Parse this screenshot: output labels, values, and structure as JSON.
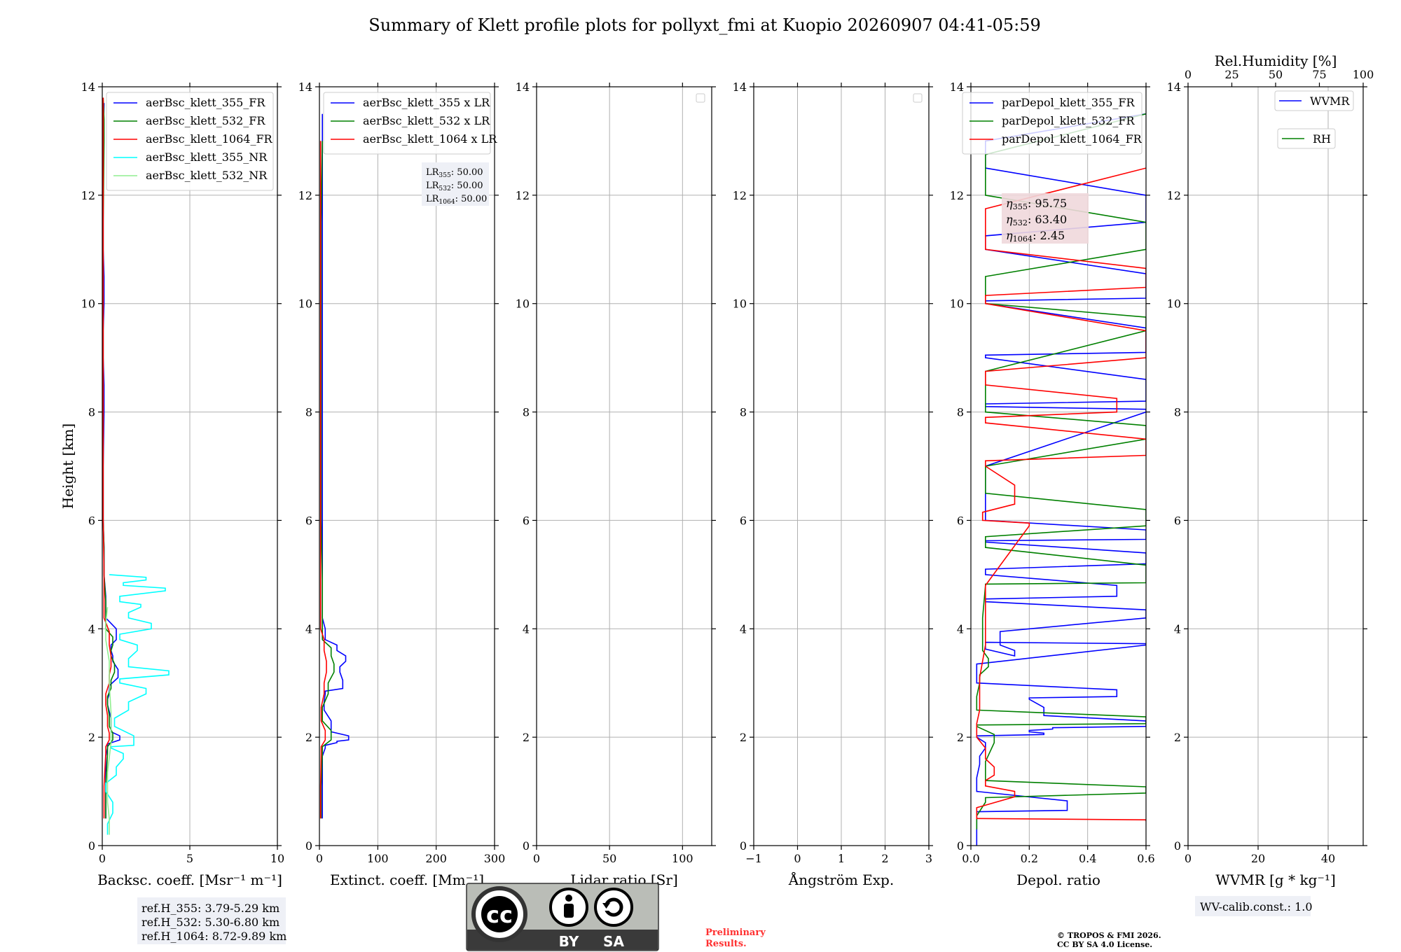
{
  "title": "Summary of Klett profile plots for pollyxt_fmi at Kuopio 20260907 04:41-05:59",
  "notes": {
    "ref_heights": [
      "ref.H_355: 3.79-5.29 km",
      "ref.H_532: 5.30-6.80 km",
      "ref.H_1064: 8.72-9.89 km"
    ],
    "preliminary": [
      "Preliminary",
      "Results."
    ],
    "copyright": [
      "© TROPOS & FMI 2026.",
      "CC BY SA 4.0 License."
    ],
    "wv_calib": "WV-calib.const.: 1.0",
    "cc_logo": {
      "by": "BY",
      "sa": "SA"
    }
  },
  "colors": {
    "blue": "#0000ff",
    "green": "#008000",
    "red": "#ff0000",
    "cyan": "#00ffff",
    "lightgreen": "#90ee90",
    "grid": "#b0b0b0"
  },
  "chart_data": [
    {
      "type": "line",
      "xlabel": "Backsc. coeff. [Msr⁻¹ m⁻¹]",
      "ylabel": "Height [km]",
      "xlim": [
        0,
        10
      ],
      "ylim": [
        0,
        14
      ],
      "xticks": [
        0,
        5,
        10
      ],
      "yticks": [
        0,
        2,
        4,
        6,
        8,
        10,
        12,
        14
      ],
      "grid": true,
      "legend_position": "top-right",
      "series": [
        {
          "name": "aerBsc_klett_355_FR",
          "color": "#0000ff",
          "x": [
            0.2,
            0.2,
            0.3,
            1.0,
            0.5,
            0.3,
            0.4,
            0.9,
            0.6,
            0.5,
            0.8,
            0.2,
            0.1,
            0.05,
            0.1,
            0.05,
            0.1,
            0.05,
            0.05,
            0.1
          ],
          "y": [
            0.5,
            1.5,
            1.8,
            1.95,
            2.1,
            2.6,
            2.8,
            3.1,
            3.4,
            3.6,
            3.8,
            4.2,
            5.0,
            6.0,
            8.0,
            9.0,
            10.0,
            11.0,
            12.0,
            13.7
          ]
        },
        {
          "name": "aerBsc_klett_532_FR",
          "color": "#008000",
          "x": [
            0.2,
            0.3,
            0.6,
            0.4,
            0.3,
            0.5,
            0.7,
            0.5,
            0.6,
            0.2,
            0.1,
            0.05,
            0.05,
            0.05,
            0.1,
            0.05
          ],
          "y": [
            0.5,
            1.7,
            1.95,
            2.2,
            2.6,
            2.9,
            3.2,
            3.5,
            3.7,
            4.0,
            5.0,
            6.0,
            8.0,
            10.0,
            13.0,
            13.8
          ]
        },
        {
          "name": "aerBsc_klett_1064_FR",
          "color": "#ff0000",
          "x": [
            0.1,
            0.2,
            0.4,
            0.3,
            0.2,
            0.4,
            0.5,
            0.4,
            0.1,
            0.05,
            0.05,
            0.05,
            0.05
          ],
          "y": [
            0.5,
            1.7,
            1.95,
            2.2,
            2.6,
            3.0,
            3.3,
            3.7,
            4.2,
            6.0,
            8.0,
            10.0,
            13.8
          ]
        },
        {
          "name": "aerBsc_klett_355_NR",
          "color": "#00ffff",
          "x": [
            0.3,
            0.6,
            0.2,
            0.8,
            1.2,
            0.5,
            1.8,
            0.7,
            1.5,
            2.5,
            1.0,
            3.8,
            1.5,
            2.0,
            1.0,
            2.8,
            1.5,
            2.2,
            1.0,
            3.6,
            1.2,
            2.5,
            0.4
          ],
          "y": [
            0.2,
            0.6,
            1.0,
            1.3,
            1.6,
            1.8,
            1.85,
            2.2,
            2.5,
            2.8,
            3.0,
            3.15,
            3.3,
            3.6,
            3.8,
            4.0,
            4.2,
            4.4,
            4.5,
            4.7,
            4.8,
            4.9,
            5.0
          ]
        },
        {
          "name": "aerBsc_klett_532_NR",
          "color": "#90ee90",
          "x": [
            0.4,
            0.3,
            0.5,
            0.4,
            0.2,
            0.3
          ],
          "y": [
            0.2,
            0.8,
            1.9,
            3.0,
            3.8,
            4.4
          ]
        }
      ]
    },
    {
      "type": "line",
      "xlabel": "Extinct. coeff. [Mm⁻¹]",
      "xlim": [
        0,
        300
      ],
      "ylim": [
        0,
        14
      ],
      "xticks": [
        0,
        100,
        200,
        300
      ],
      "yticks": [
        0,
        2,
        4,
        6,
        8,
        10,
        12,
        14
      ],
      "grid": true,
      "legend_position": "top-right",
      "annotation": [
        "LR355: 50.00",
        "LR532: 50.00",
        "LR1064: 50.00"
      ],
      "series": [
        {
          "name": "aerBsc_klett_355 x LR",
          "color": "#0000ff",
          "x": [
            5,
            5,
            10,
            30,
            50,
            20,
            8,
            10,
            40,
            35,
            45,
            30,
            10,
            5,
            5,
            5,
            5,
            5
          ],
          "y": [
            0.5,
            1.5,
            1.8,
            1.9,
            1.95,
            2.1,
            2.5,
            2.8,
            2.9,
            3.2,
            3.4,
            3.6,
            3.8,
            4.2,
            6.0,
            8.0,
            11.0,
            13.5
          ]
        },
        {
          "name": "aerBsc_klett_532 x LR",
          "color": "#008000",
          "x": [
            3,
            5,
            20,
            5,
            15,
            25,
            20,
            5,
            3,
            3,
            5
          ],
          "y": [
            0.5,
            1.7,
            1.95,
            2.3,
            2.8,
            3.2,
            3.5,
            3.8,
            6.0,
            10.0,
            13.0
          ]
        },
        {
          "name": "aerBsc_klett_1064 x LR",
          "color": "#ff0000",
          "x": [
            2,
            3,
            10,
            3,
            8,
            12,
            8,
            2,
            2
          ],
          "y": [
            0.5,
            1.7,
            1.95,
            2.3,
            2.8,
            3.2,
            3.6,
            4.0,
            13.0
          ]
        }
      ]
    },
    {
      "type": "line",
      "xlabel": "Lidar ratio [Sr]",
      "xlim": [
        0,
        120
      ],
      "ylim": [
        0,
        14
      ],
      "xticks": [
        0,
        50,
        100
      ],
      "yticks": [
        0,
        2,
        4,
        6,
        8,
        10,
        12,
        14
      ],
      "grid": true,
      "series": []
    },
    {
      "type": "line",
      "xlabel": "Ångström Exp.",
      "xlim": [
        -1,
        3
      ],
      "ylim": [
        0,
        14
      ],
      "xticks": [
        -1,
        0,
        1,
        2,
        3
      ],
      "yticks": [
        0,
        2,
        4,
        6,
        8,
        10,
        12,
        14
      ],
      "grid": true,
      "series": []
    },
    {
      "type": "line",
      "xlabel": "Depol. ratio",
      "xlim": [
        0,
        0.6
      ],
      "ylim": [
        0,
        14
      ],
      "xticks": [
        0.0,
        0.2,
        0.4,
        0.6
      ],
      "yticks": [
        0,
        2,
        4,
        6,
        8,
        10,
        12,
        14
      ],
      "grid": true,
      "legend_position": "top-right",
      "annotation": [
        "η355: 95.75",
        "η532: 63.40",
        "η1064: 2.45"
      ],
      "series": [
        {
          "name": "parDepol_klett_355_FR",
          "color": "#0000ff",
          "x": [
            0.02,
            0.02,
            0.33,
            0.02,
            0.03,
            0.05,
            0.02,
            0.25,
            0.2,
            0.28,
            0.6,
            0.25,
            0.2,
            0.5,
            0.02,
            0.6,
            0.05,
            0.15,
            0.1,
            0.6,
            0.05,
            0.5,
            0.05,
            0.6,
            0.05,
            0.6,
            0.05,
            0.6,
            0.05,
            0.6,
            0.05,
            0.6,
            0.05,
            0.6,
            0.05,
            0.6,
            0.05,
            0.6
          ],
          "y": [
            0.0,
            0.6,
            0.65,
            1.0,
            1.5,
            1.8,
            2.0,
            2.05,
            2.1,
            2.15,
            2.2,
            2.4,
            2.7,
            2.75,
            3.0,
            3.7,
            3.75,
            3.5,
            3.7,
            4.2,
            4.5,
            4.6,
            5.0,
            5.2,
            5.6,
            5.65,
            6.0,
            8.0,
            8.1,
            8.2,
            9.0,
            9.1,
            10.0,
            10.1,
            11.0,
            11.5,
            12.5,
            13.5
          ]
        },
        {
          "name": "parDepol_klett_532_FR",
          "color": "#008000",
          "x": [
            0.02,
            0.05,
            0.6,
            0.05,
            0.08,
            0.02,
            0.6,
            0.02,
            0.03,
            0.06,
            0.04,
            0.05,
            0.6,
            0.05,
            0.6,
            0.05,
            0.6,
            0.05,
            0.6,
            0.05,
            0.6,
            0.05,
            0.6
          ],
          "y": [
            0.3,
            0.8,
            0.97,
            1.2,
            1.9,
            2.2,
            2.25,
            2.5,
            3.0,
            3.3,
            3.6,
            4.8,
            4.85,
            5.5,
            5.9,
            6.5,
            7.5,
            8.0,
            9.5,
            10.0,
            11.0,
            12.0,
            13.5
          ]
        },
        {
          "name": "parDepol_klett_1064_FR",
          "color": "#ff0000",
          "x": [
            0.6,
            0.02,
            0.15,
            0.05,
            0.08,
            0.05,
            0.02,
            0.03,
            0.05,
            0.2,
            0.04,
            0.15,
            0.05,
            0.6,
            0.05,
            0.5,
            0.05,
            0.6,
            0.05,
            0.6,
            0.05,
            0.6
          ],
          "y": [
            0.45,
            0.5,
            0.9,
            1.1,
            1.3,
            1.6,
            2.0,
            2.5,
            3.7,
            5.9,
            6.0,
            6.3,
            7.0,
            7.2,
            7.8,
            8.0,
            8.5,
            9.0,
            10.0,
            10.3,
            11.0,
            12.5
          ]
        }
      ]
    },
    {
      "type": "line",
      "xlabel": "WVMR [g * kg⁻¹]",
      "xlabel2": "Rel.Humidity [%]",
      "xlim": [
        0,
        50
      ],
      "ylim": [
        0,
        14
      ],
      "xticks": [
        0,
        20,
        40
      ],
      "yticks": [
        0,
        2,
        4,
        6,
        8,
        10,
        12,
        14
      ],
      "x2lim": [
        0,
        100
      ],
      "x2ticks": [
        0,
        25,
        50,
        75,
        100
      ],
      "grid": true,
      "legend_position": "top-right",
      "series": [
        {
          "name": "WVMR",
          "color": "#0000ff",
          "x": [],
          "y": []
        },
        {
          "name": "RH",
          "color": "#008000",
          "x": [],
          "y": []
        }
      ]
    }
  ]
}
